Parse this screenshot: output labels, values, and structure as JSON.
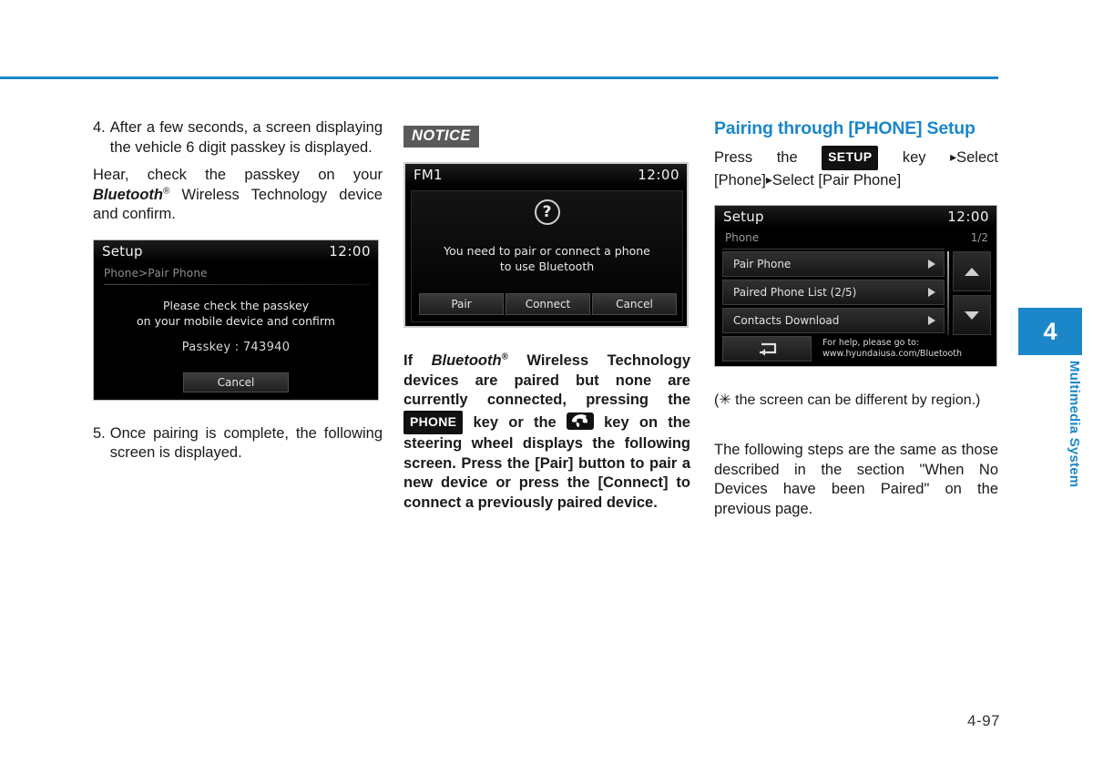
{
  "page": {
    "number": "4-97",
    "chapter_number": "4",
    "chapter_label": "Multimedia System",
    "accent_color": "#1b87c9"
  },
  "left_column": {
    "step4": {
      "number": "4.",
      "text": "After a few seconds, a screen displaying the vehicle 6 digit passkey is displayed.",
      "sub_text_a": "Hear, check the passkey on your ",
      "sub_text_bluetooth": "Bluetooth",
      "sub_text_reg": "®",
      "sub_text_b": " Wireless Technology device and confirm."
    },
    "passkey_screen": {
      "title": "Setup",
      "clock": "12:00",
      "breadcrumb": "Phone>Pair Phone",
      "message_line1": "Please check the passkey",
      "message_line2": "on your mobile device and confirm",
      "passkey_label": "Passkey : 743940",
      "cancel_button": "Cancel"
    },
    "step5": {
      "number": "5.",
      "text": "Once pairing is complete, the following screen is displayed."
    }
  },
  "middle_column": {
    "notice_badge": "NOTICE",
    "fm_screen": {
      "title": "FM1",
      "clock": "12:00",
      "question_glyph": "?",
      "message_line1": "You need to pair or connect a phone",
      "message_line2": "to use Bluetooth",
      "buttons": [
        "Pair",
        "Connect",
        "Cancel"
      ]
    },
    "bold_paragraph": {
      "part1": "If ",
      "bluetooth": "Bluetooth",
      "reg": "®",
      "part2": " Wireless Technology devices are paired but none are currently connected, pressing the ",
      "phone_key_badge": "PHONE",
      "part3": " key or the ",
      "part4": " key on the steering wheel displays the following screen. Press the [Pair] button to pair a new device or press the [Connect] to connect a previously paired device."
    }
  },
  "right_column": {
    "heading": "Pairing through [PHONE] Setup",
    "intro": {
      "part1": "Press   the   ",
      "setup_key_badge": "SETUP",
      "part2": "   key   ",
      "arrow1": "▸",
      "part3": "Select [Phone]",
      "arrow2": "▸",
      "part4": "Select [Pair Phone]"
    },
    "setup_screen": {
      "title": "Setup",
      "clock": "12:00",
      "sub_label": "Phone",
      "page_indicator": "1/2",
      "rows": [
        "Pair Phone",
        "Paired Phone List (2/5)",
        "Contacts Download"
      ],
      "help_line1": "For help, please go to:",
      "help_line2": "www.hyundaiusa.com/Bluetooth"
    },
    "region_note": "(✳ the screen can be different by region.)",
    "closing_paragraph": "The following steps are the same as those described in the section \"When No Devices have been Paired\" on the previous page."
  }
}
